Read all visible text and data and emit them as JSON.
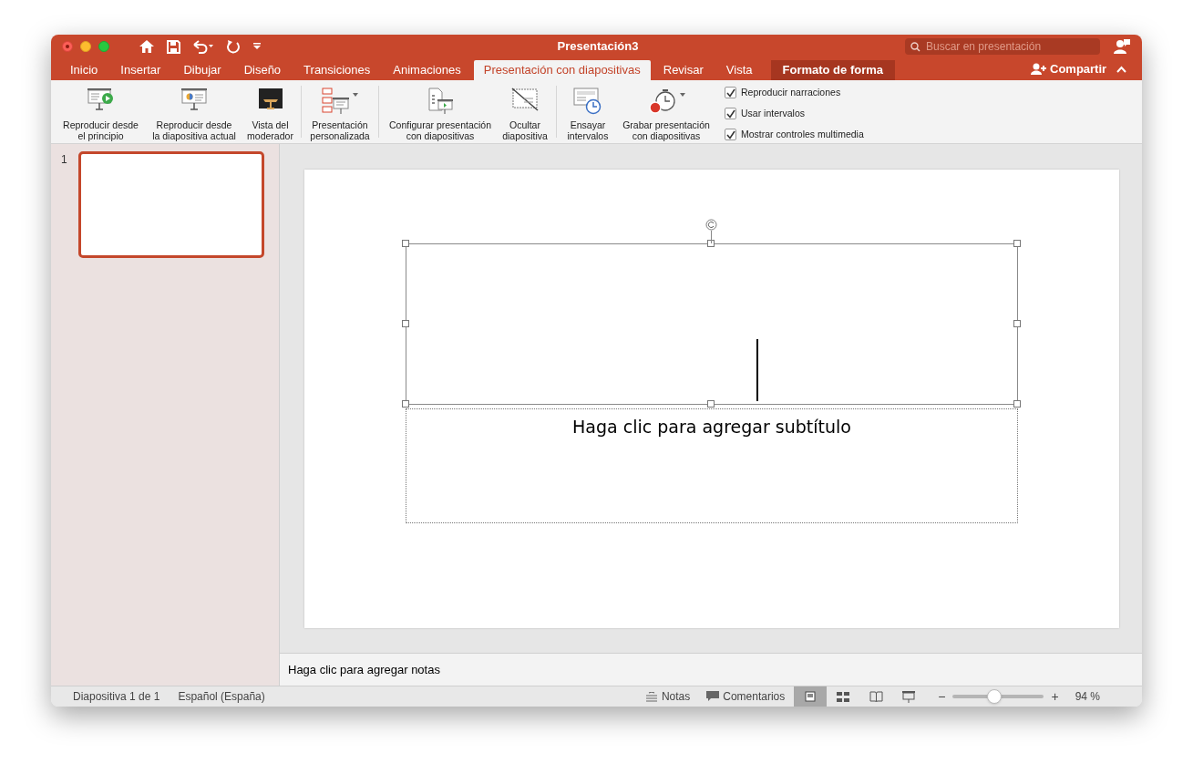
{
  "window": {
    "title": "Presentación3"
  },
  "search": {
    "placeholder": "Buscar en presentación"
  },
  "tabs": [
    {
      "label": "Inicio",
      "selected": false,
      "kind": "normal"
    },
    {
      "label": "Insertar",
      "selected": false,
      "kind": "normal"
    },
    {
      "label": "Dibujar",
      "selected": false,
      "kind": "normal"
    },
    {
      "label": "Diseño",
      "selected": false,
      "kind": "normal"
    },
    {
      "label": "Transiciones",
      "selected": false,
      "kind": "normal"
    },
    {
      "label": "Animaciones",
      "selected": false,
      "kind": "normal"
    },
    {
      "label": "Presentación con diapositivas",
      "selected": true,
      "kind": "normal"
    },
    {
      "label": "Revisar",
      "selected": false,
      "kind": "normal"
    },
    {
      "label": "Vista",
      "selected": false,
      "kind": "normal"
    },
    {
      "label": "Formato de forma",
      "selected": false,
      "kind": "contextual"
    }
  ],
  "share_button": {
    "label": "Compartir"
  },
  "ribbon": {
    "groups": [
      [
        {
          "lines": [
            "Reproducir desde",
            "el principio"
          ],
          "dropdown": false
        },
        {
          "lines": [
            "Reproducir desde",
            "la diapositiva actual"
          ],
          "dropdown": false
        },
        {
          "lines": [
            "Vista del",
            "moderador"
          ],
          "dropdown": false
        }
      ],
      [
        {
          "lines": [
            "Presentación",
            "personalizada"
          ],
          "dropdown": true
        }
      ],
      [
        {
          "lines": [
            "Configurar presentación",
            "con diapositivas"
          ],
          "dropdown": false
        },
        {
          "lines": [
            "Ocultar",
            "diapositiva"
          ],
          "dropdown": false
        }
      ],
      [
        {
          "lines": [
            "Ensayar",
            "intervalos"
          ],
          "dropdown": false
        },
        {
          "lines": [
            "Grabar presentación",
            "con diapositivas"
          ],
          "dropdown": true
        }
      ]
    ],
    "checkboxes": [
      {
        "label": "Reproducir narraciones",
        "checked": true
      },
      {
        "label": "Usar intervalos",
        "checked": true
      },
      {
        "label": "Mostrar controles multimedia",
        "checked": true
      }
    ]
  },
  "thumbnails": [
    {
      "number": "1",
      "selected": true
    }
  ],
  "slide": {
    "subtitle_placeholder": "Haga clic para agregar subtítulo"
  },
  "notes": {
    "placeholder": "Haga clic para agregar notas"
  },
  "status_bar": {
    "slide_info": "Diapositiva 1 de 1",
    "language": "Español (España)",
    "notes_button": "Notas",
    "comments_button": "Comentarios",
    "views": [
      {
        "kind": "normal",
        "selected": true
      },
      {
        "kind": "sorter",
        "selected": false
      },
      {
        "kind": "reading",
        "selected": false
      },
      {
        "kind": "slideshow",
        "selected": false
      }
    ],
    "zoom": {
      "minus": "−",
      "plus": "+",
      "level": 0.46,
      "reading": "94 %"
    }
  }
}
